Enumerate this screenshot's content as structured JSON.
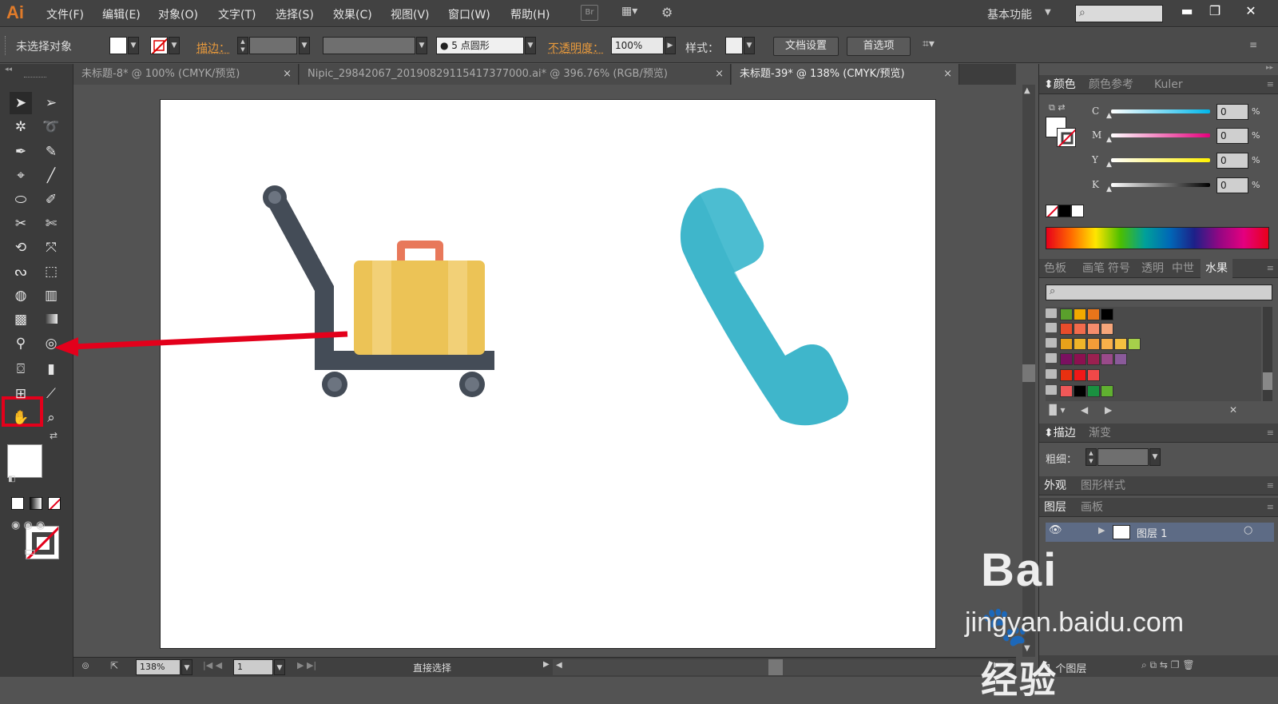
{
  "app": {
    "logo": "Ai"
  },
  "menu": [
    "文件(F)",
    "编辑(E)",
    "对象(O)",
    "文字(T)",
    "选择(S)",
    "效果(C)",
    "视图(V)",
    "窗口(W)",
    "帮助(H)"
  ],
  "bridge_label": "Br",
  "workspace": "基本功能",
  "control": {
    "no_selection": "未选择对象",
    "stroke_label": "描边：",
    "brush_label": "5 点圆形",
    "opacity_label": "不透明度：",
    "opacity_value": "100%",
    "style_label": "样式：",
    "doc_setup": "文档设置",
    "preferences": "首选项"
  },
  "tabs": [
    {
      "label": "未标题-8* @ 100% (CMYK/预览)"
    },
    {
      "label": "Nipic_29842067_20190829115417377000.ai* @ 396.76% (RGB/预览)"
    },
    {
      "label": "未标题-39* @ 138% (CMYK/预览)",
      "active": true
    }
  ],
  "status": {
    "zoom": "138%",
    "page": "1",
    "tool_name": "直接选择"
  },
  "color_panel": {
    "tabs": [
      "颜色",
      "颜色参考",
      "Kuler"
    ],
    "channels": [
      {
        "name": "C",
        "value": "0",
        "unit": "%"
      },
      {
        "name": "M",
        "value": "0",
        "unit": "%"
      },
      {
        "name": "Y",
        "value": "0",
        "unit": "%"
      },
      {
        "name": "K",
        "value": "0",
        "unit": "%"
      }
    ]
  },
  "swatch_panel": {
    "tabs": [
      "色板",
      "画笔",
      "符号",
      "透明",
      "中世",
      "水果"
    ],
    "rows": [
      [
        "#5aa02c",
        "#f2a900",
        "#e8751a",
        "#000000"
      ],
      [
        "#e84c2b",
        "#f26b4c",
        "#f58c6c",
        "#f7a67a"
      ],
      [
        "#e8a21a",
        "#f0b429",
        "#f29c38",
        "#f8b04a",
        "#f5c040",
        "#a6d04a"
      ],
      [
        "#7a1060",
        "#8c1050",
        "#9a2050",
        "#9a4a8a",
        "#8a5a9a"
      ],
      [
        "#e83010",
        "#f01818",
        "#f04848"
      ],
      [
        "#f05858",
        "#000000",
        "#1a9040",
        "#60b030"
      ]
    ]
  },
  "stroke_panel": {
    "tabs": [
      "描边",
      "渐变"
    ],
    "weight_label": "粗细："
  },
  "appearance_panel": {
    "tabs": [
      "外观",
      "图形样式"
    ]
  },
  "layers_panel": {
    "tabs": [
      "图层",
      "画板"
    ],
    "layer_name": "图层 1",
    "footer": "1 个图层"
  },
  "watermark": {
    "brand": "Bai",
    "brand2": "经验",
    "url": "jingyan.baidu.com"
  },
  "colors": {
    "suitcase": "#ecc356",
    "cart": "#444c57",
    "handle": "#e8785a",
    "phone": "#3fb6cb",
    "highlight": "#e3001b"
  }
}
